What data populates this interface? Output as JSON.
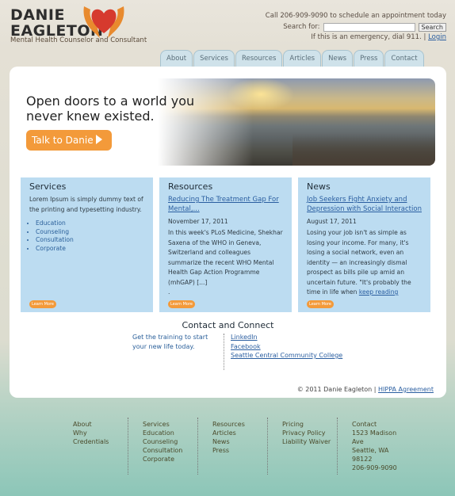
{
  "logo": {
    "line1": "DANIE",
    "line2": "EAGLETON",
    "tagline": "Mental Health Counselor and Consultant"
  },
  "header": {
    "phone_text": "Call 206-909-9090 to schedule an appointment today",
    "search_label": "Search for:",
    "search_placeholder": "",
    "search_button": "Search",
    "emergency_text": "If this is an emergency, dial 911.",
    "separator": "|",
    "login_link": "Login"
  },
  "nav": {
    "tabs": [
      "About",
      "Services",
      "Resources",
      "Articles",
      "News",
      "Press",
      "Contact"
    ]
  },
  "hero": {
    "title_line1": "Open doors to a world you",
    "title_line2": "never knew existed.",
    "cta": "Talk to Danie"
  },
  "columns": {
    "services": {
      "title": "Services",
      "text": "Lorem Ipsum is simply dummy text of the printing and typesetting industry.",
      "items": [
        "Education",
        "Counseling",
        "Consultation",
        "Corporate"
      ],
      "more": "Learn More"
    },
    "resources": {
      "title": "Resources",
      "article_title": "Reducing The Treatment Gap For Mental,...",
      "date": "November 17, 2011",
      "text": "In this week's PLoS Medicine, Shekhar Saxena of the WHO in Geneva, Switzerland and colleagues summarize the recent WHO Mental Health Gap Action Programme (mhGAP) [...]",
      "dot": ".",
      "more": "Learn More"
    },
    "news": {
      "title": "News",
      "article_title": "Job Seekers Fight Anxiety and Depression with Social Interaction",
      "date": "August 17, 2011",
      "text": "Losing your job isn't as simple as losing your income. For many, it's losing a social network, even an identity — an increasingly dismal prospect as bills pile up amid an uncertain future. \"It's probably the time in life when",
      "keep_reading": "keep reading",
      "more": "Learn More"
    }
  },
  "contact": {
    "title": "Contact and Connect",
    "blurb": "Get the training to start your new life today.",
    "links": [
      "LinkedIn",
      "Facebook",
      "Seattle Central Community College"
    ]
  },
  "copyright": {
    "text": "© 2011 Danie Eagleton |",
    "link": "HIPPA Agreement"
  },
  "footer": {
    "col1": [
      "About",
      "Why",
      "Credentials"
    ],
    "col2": [
      "Services",
      "Education",
      "Counseling",
      "Consultation",
      "Corporate"
    ],
    "col3": [
      "Resources",
      "Articles",
      "News",
      "Press"
    ],
    "col4": [
      "Pricing",
      "Privacy Policy",
      "Liability Waiver"
    ],
    "col5": [
      "Contact",
      "1523 Madison",
      "Ave",
      "Seattle, WA",
      "98122",
      "206-909-9090"
    ]
  },
  "colors": {
    "accent_orange": "#f39a3a",
    "column_bg": "#bcdcf1",
    "link_blue": "#2a5ea0",
    "heart_red": "#d63a2e",
    "hands_orange": "#e88a2e"
  }
}
